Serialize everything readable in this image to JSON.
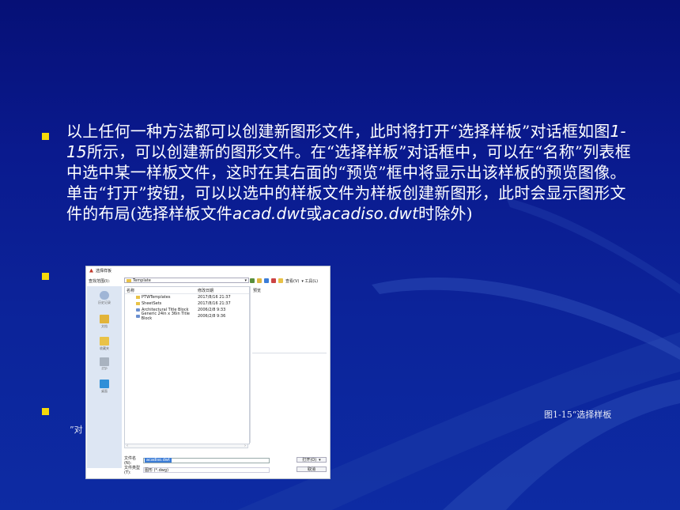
{
  "slide": {
    "background_color": "#0a1f93",
    "bullet_color": "#f5d90a",
    "text_color": "#ffffff",
    "paragraph_parts": [
      "以上任何一种方法都可以创建新图形文件，此时将打开“选择样板”对话框如图",
      "1-15",
      "所示，可以创建新的图形文件。在“选择样板”对话框中，可以在“名称”列表框中选中某一样板文件，这时在其右面的“预览”框中将显示出该样板的预览图像。单击“打开”按钮，可以以选中的样板文件为样板创建新图形，此时会显示图形文件的布局(选择样板文件",
      "acad.dwt",
      "或",
      "acadiso.dwt",
      "时除外)"
    ],
    "caption_line1": "图1-15“选择样板",
    "caption_line2": "”对"
  },
  "dialog": {
    "title": "选择样板",
    "look_in_label": "查找范围(I):",
    "look_in_value": "Template",
    "toolbar_icons": [
      "back-icon",
      "up-folder-icon",
      "search-web-icon",
      "delete-icon",
      "new-folder-icon",
      "views-icon"
    ],
    "views_label": "查看(V)",
    "tools_label": "▾ 工具(L)",
    "sidebar": [
      {
        "label": "历史记录",
        "icon": "history-icon"
      },
      {
        "label": "文档",
        "icon": "documents-icon"
      },
      {
        "label": "收藏夹",
        "icon": "favorites-icon"
      },
      {
        "label": "FTP",
        "icon": "ftp-icon"
      },
      {
        "label": "桌面",
        "icon": "desktop-icon"
      }
    ],
    "columns": {
      "name": "名称",
      "date": "修改日期"
    },
    "files": [
      {
        "name": "PTWTemplates",
        "date": "2017/8/16 21:37",
        "type": "folder"
      },
      {
        "name": "SheetSets",
        "date": "2017/8/16 21:37",
        "type": "folder"
      },
      {
        "name": "Architectural Title Block",
        "date": "2006/2/8 9:33",
        "type": "template"
      },
      {
        "name": "Generic 24in x 36in Title Block",
        "date": "2006/2/8 9:36",
        "type": "template"
      }
    ],
    "preview_label": "预览",
    "file_name_label": "文件名(N):",
    "file_name_value": "acadiso.dwt",
    "file_type_label": "文件类型(T):",
    "file_type_value": "图形 (*.dwg)",
    "open_button": "打开(O)",
    "cancel_button": "取消"
  }
}
